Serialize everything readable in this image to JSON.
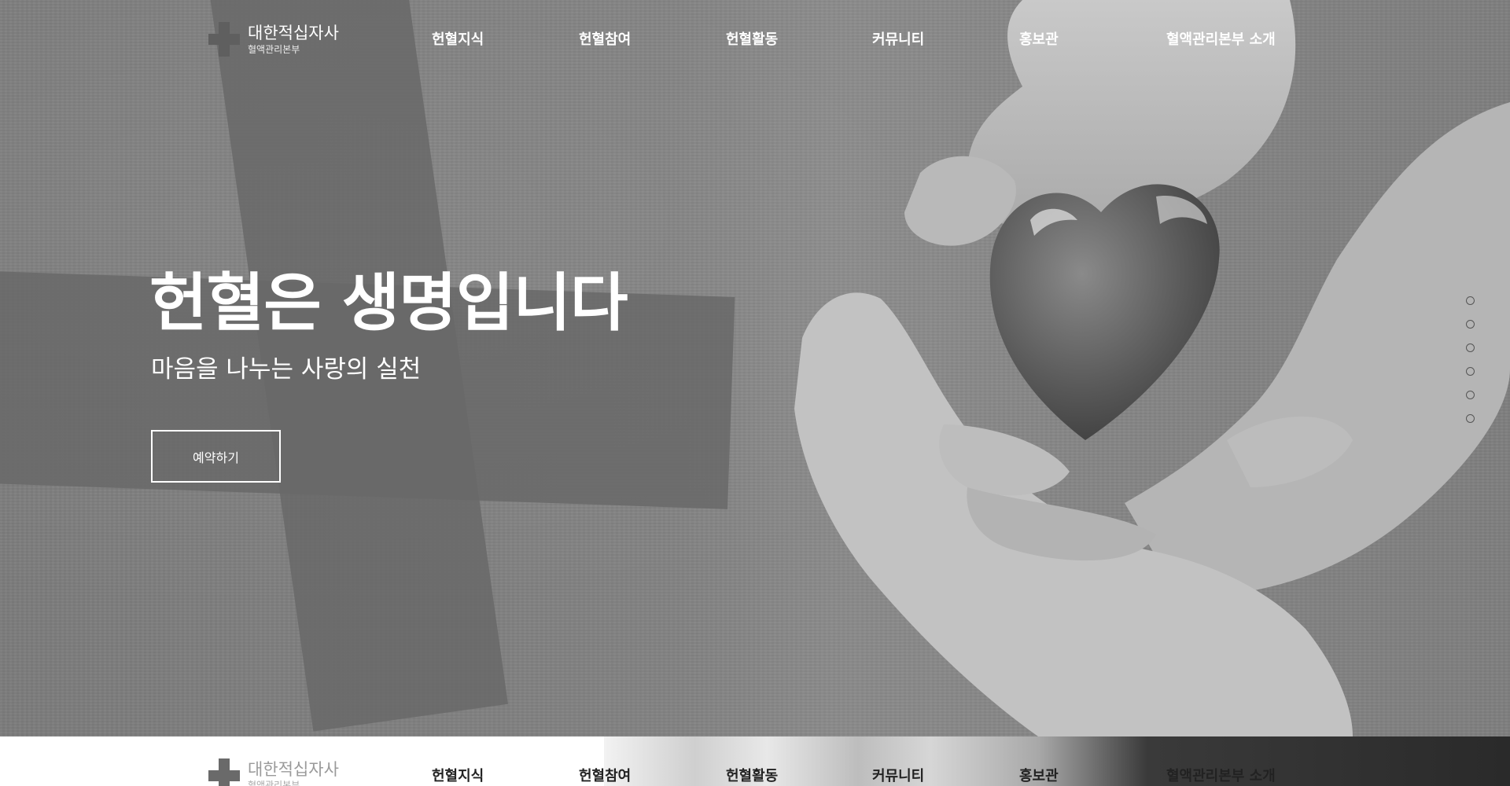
{
  "header": {
    "logo_title": "대한적십자사",
    "logo_subtitle": "혈액관리본부",
    "nav": [
      "헌혈지식",
      "헌혈참여",
      "헌혈활동",
      "커뮤니티",
      "홍보관",
      "혈액관리본부 소개"
    ]
  },
  "hero": {
    "title": "헌혈은 생명입니다",
    "subtitle": "마음을 나누는 사랑의 실천",
    "button_label": "예약하기"
  },
  "pagination": {
    "count": 6,
    "icon": "circle-outline-icon"
  },
  "colors": {
    "hero_bg": "#7f7f7f",
    "cross_overlay": "#696969",
    "text": "#ffffff",
    "dot_border": "#555555"
  }
}
